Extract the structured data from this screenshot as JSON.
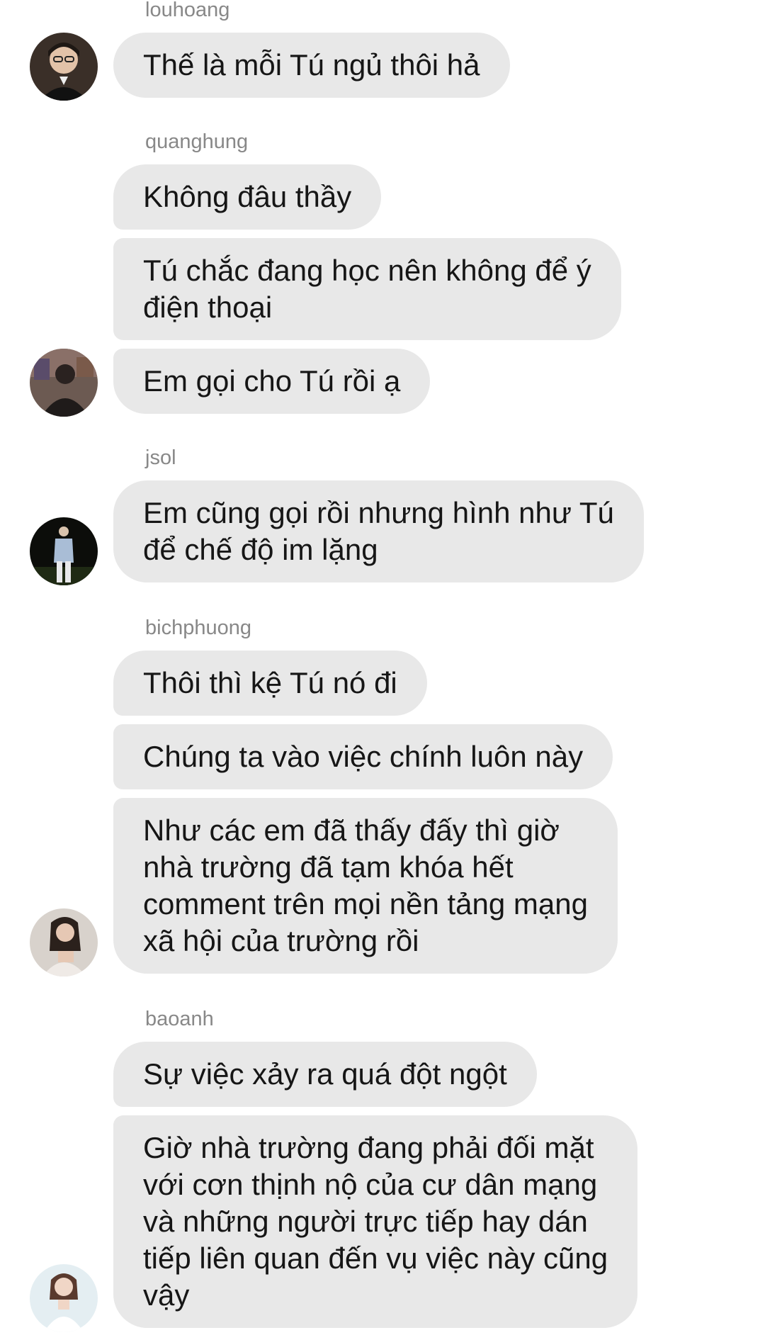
{
  "messages": [
    {
      "sender": "louhoang",
      "avatar": "avatar-louhoang",
      "bubbles": [
        "Thế là mỗi Tú ngủ thôi hả"
      ]
    },
    {
      "sender": "quanghung",
      "avatar": "avatar-quanghung",
      "bubbles": [
        "Không đâu thầy",
        "Tú chắc đang học nên không để ý\nđiện thoại",
        "Em gọi cho Tú rồi ạ"
      ]
    },
    {
      "sender": "jsol",
      "avatar": "avatar-jsol",
      "bubbles": [
        "Em cũng gọi rồi nhưng hình như Tú\nđể chế độ im lặng"
      ]
    },
    {
      "sender": "bichphuong",
      "avatar": "avatar-bichphuong",
      "bubbles": [
        "Thôi thì kệ Tú nó đi",
        "Chúng ta vào việc chính luôn này",
        "Như các em đã thấy đấy thì giờ\nnhà trường đã tạm khóa hết\ncomment trên mọi nền tảng mạng\nxã hội của trường rồi"
      ]
    },
    {
      "sender": "baoanh",
      "avatar": "avatar-baoanh",
      "bubbles": [
        "Sự việc xảy ra quá đột ngột",
        "Giờ nhà trường đang phải đối mặt\nvới cơn thịnh nộ của cư dân mạng\nvà những người trực tiếp hay dán\ntiếp liên quan đến vụ việc này cũng\nvậy"
      ]
    }
  ],
  "colors": {
    "bubble_bg": "#e8e8e8",
    "text": "#161616",
    "sender_name": "#888888",
    "background": "#ffffff"
  }
}
